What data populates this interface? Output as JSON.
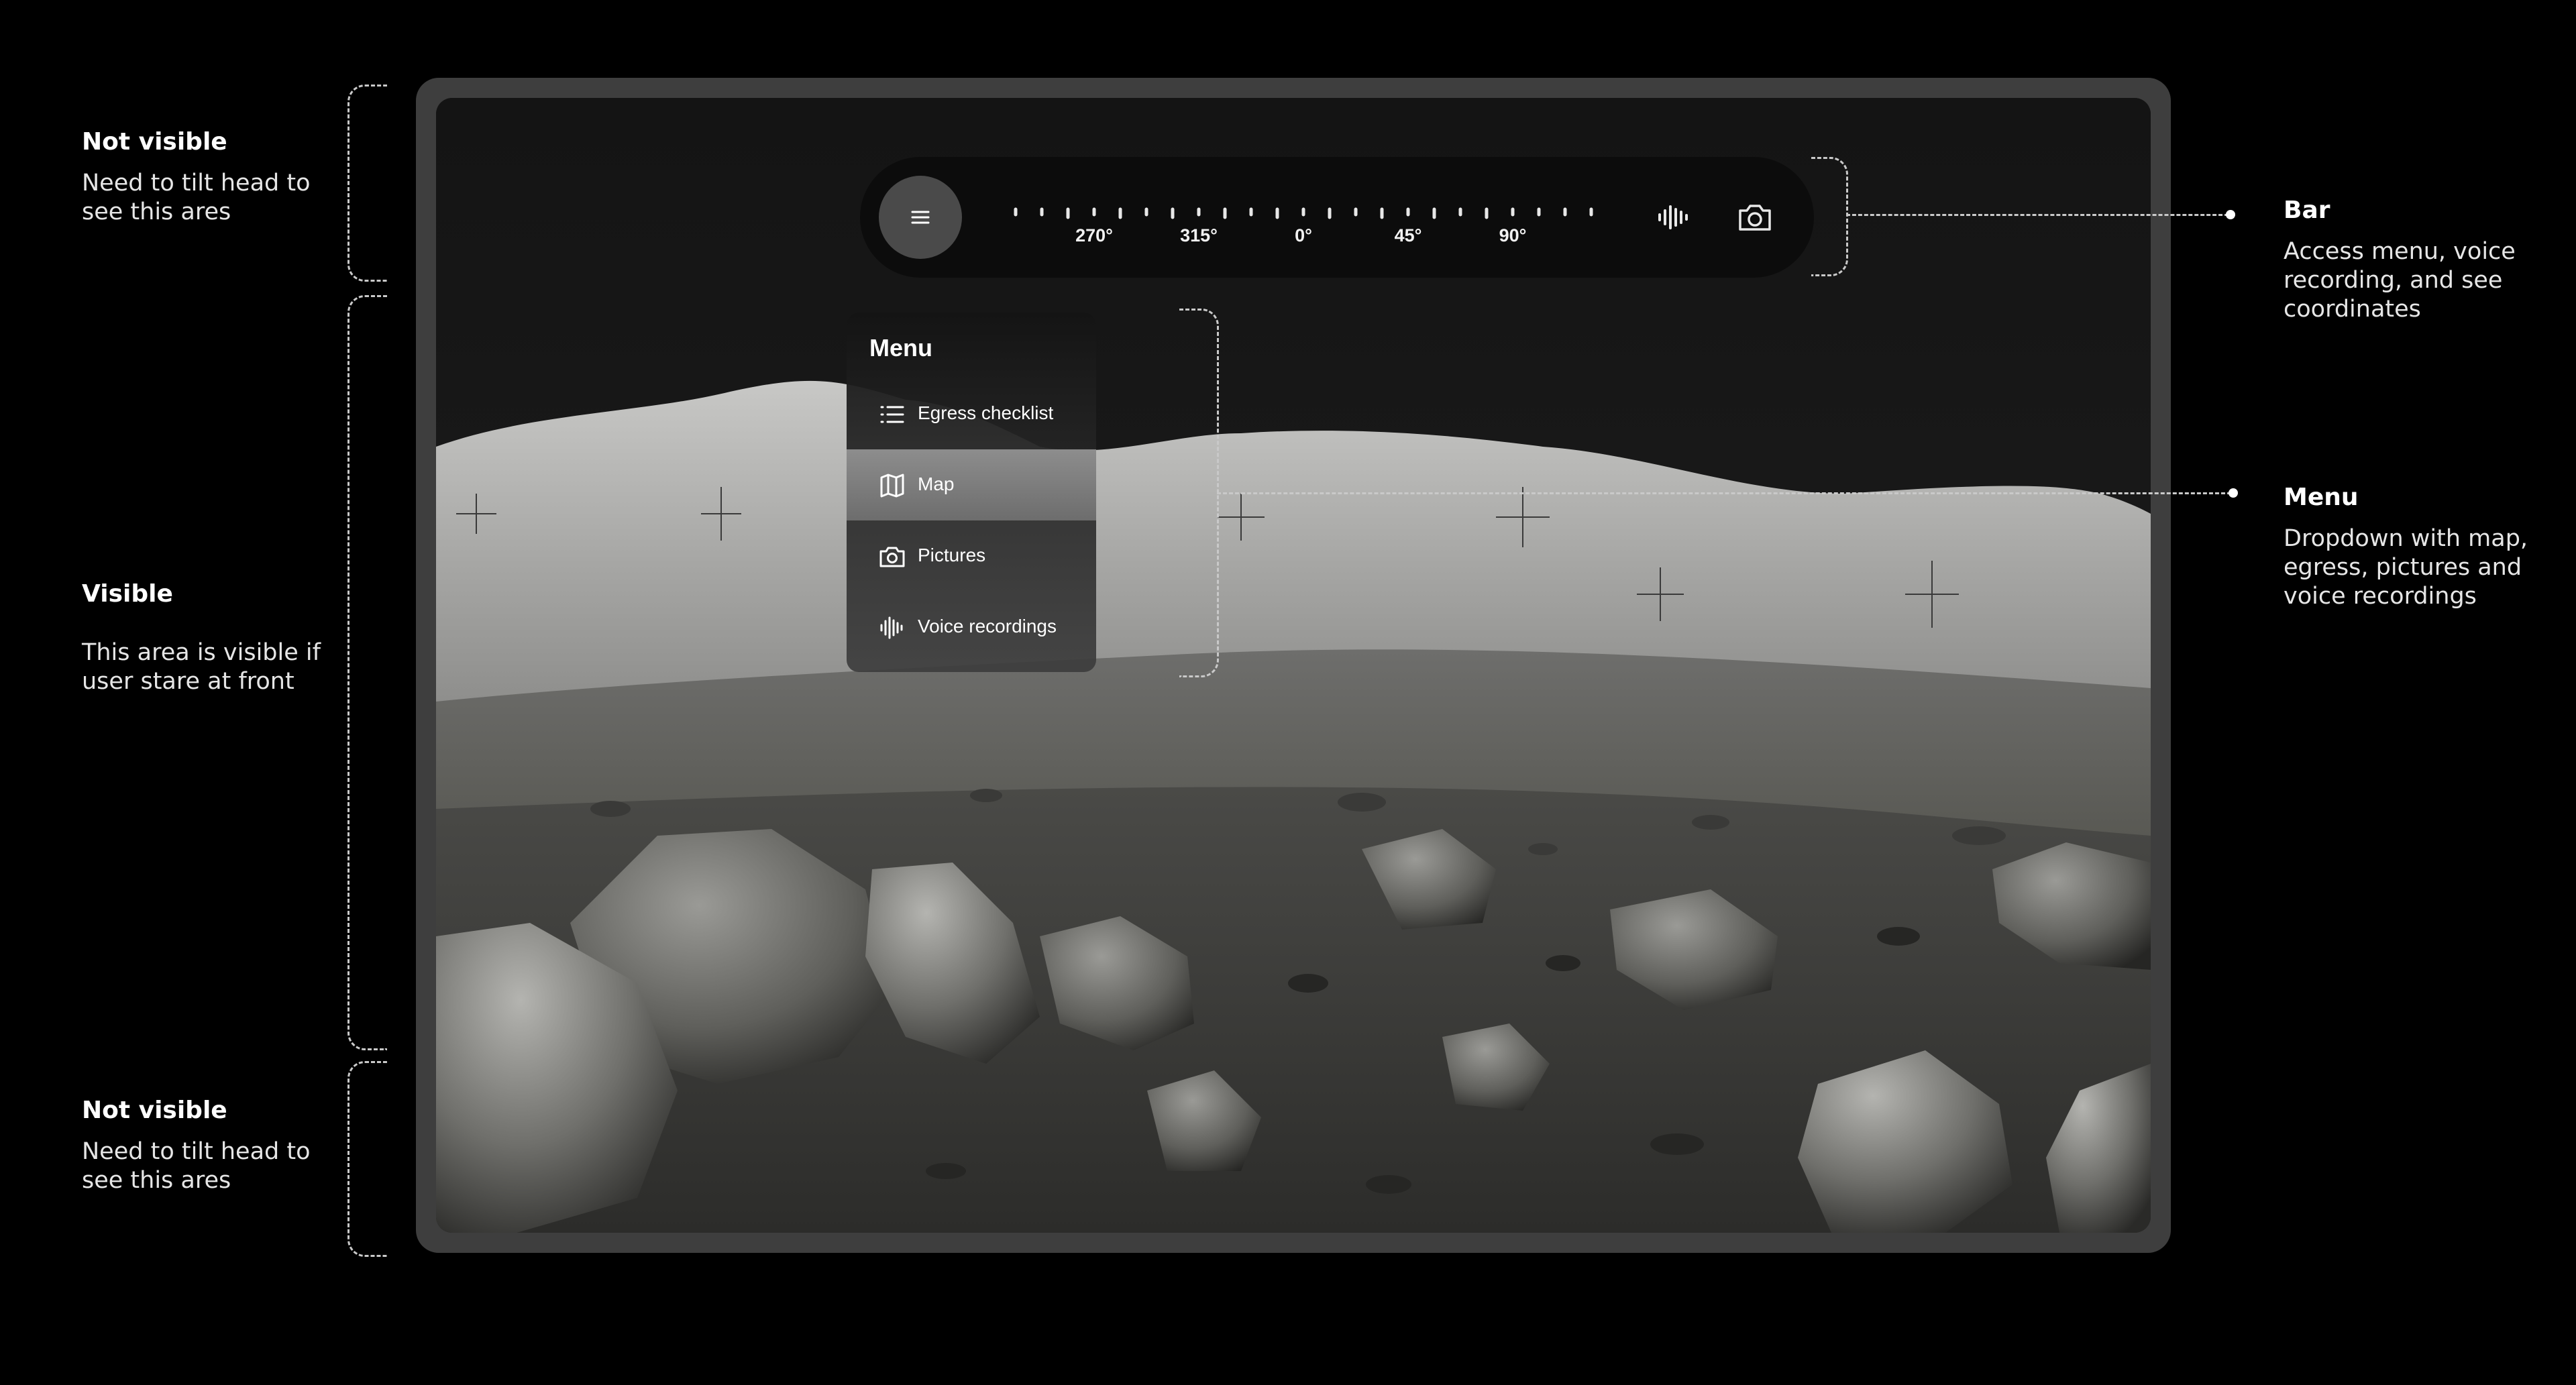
{
  "annotations": {
    "top": {
      "title": "Not visible",
      "desc": "Need to tilt head to\nsee this ares"
    },
    "middle": {
      "title": "Visible",
      "desc": "This area is visible if\nuser stare at front"
    },
    "bottom": {
      "title": "Not visible",
      "desc": "Need to tilt head to\nsee this ares"
    },
    "bar": {
      "title": "Bar",
      "desc": "Access menu, voice\nrecording, and see\ncoordinates"
    },
    "menu": {
      "title": "Menu",
      "desc": "Dropdown with map,\negress, pictures and\nvoice recordings"
    }
  },
  "bar": {
    "menu_icon": "hamburger-icon",
    "compass_labels": [
      "270°",
      "315°",
      "0°",
      "45°",
      "90°"
    ],
    "voice_icon": "waveform-icon",
    "camera_icon": "camera-icon"
  },
  "menu": {
    "title": "Menu",
    "items": [
      {
        "label": "Egress checklist",
        "icon": "checklist-icon",
        "active": false
      },
      {
        "label": "Map",
        "icon": "map-icon",
        "active": true
      },
      {
        "label": "Pictures",
        "icon": "camera-icon",
        "active": false
      },
      {
        "label": "Voice recordings",
        "icon": "waveform-icon",
        "active": false
      }
    ]
  },
  "colors": {
    "background": "#000000",
    "frame": "#3e3e3e",
    "bar": "#0c0c0c",
    "menu_active": "#7d7d7d",
    "annotation_line": "#c9c9c9"
  }
}
